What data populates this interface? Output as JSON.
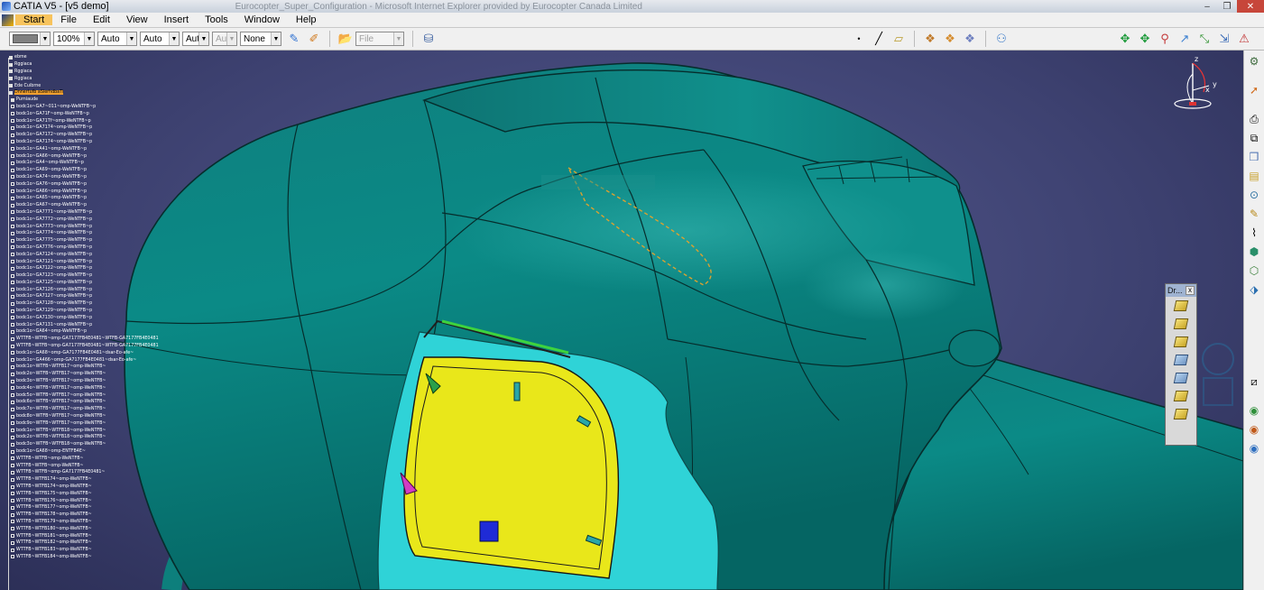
{
  "window": {
    "title": "CATIA V5 - [v5 demo]",
    "blurred_caption": "Eurocopter_Super_Configuration - Microsoft Internet Explorer provided by Eurocopter Canada Limited",
    "minimize_glyph": "–",
    "restore_glyph": "❐",
    "close_glyph": "✕"
  },
  "menu": {
    "items": [
      "Start",
      "File",
      "Edit",
      "View",
      "Insert",
      "Tools",
      "Window",
      "Help"
    ]
  },
  "toolbar": {
    "zoom_value": "100%",
    "line_type_value": "Auto",
    "line_thickness_value": "Auto",
    "layer_value": "Aut",
    "linetype_disabled_value": "Aut",
    "rendering_value": "None",
    "file_combo_value": "File"
  },
  "tree": {
    "selected_index": 5,
    "items": [
      "ebme",
      "Rggiaca",
      "Rggiaca",
      "Rggiaca",
      "Ede Cuibrne",
      "Dnnertufb aSlerhdbaTi",
      "Purniaude",
      "bodc1o~GA7~011~omp-WeNTFB~p",
      "bodc1o~GA71F~omp-WeNTFB~p",
      "bodc1o~GA71Tf~omp-WeNTFB~p",
      "bodc1o~GA7174~omp-WeNTFB~p",
      "bodc1o~GA7172~omp-WeNTFB~p",
      "bodc1o~GA7174~omp-WeNTFB~p",
      "bodc1o~GA41~omp-WeNTFB~p",
      "bodc1o~GA66~omp-WeNTFB~p",
      "bodc1o~GA4~omp-WeNTFB~p",
      "bodc1o~GA69~omp-WeNTFB~p",
      "bodc1o~GA74~omp-WeNTFB~p",
      "bodc1o~GA76~omp-WeNTFB~p",
      "bodc1o~GA66~omp-WeNTFB~p",
      "bodc1o~GA65~omp-WeNTFB~p",
      "bodc1o~GA67~omp-WeNTFB~p",
      "bodc1o~GA7771~omp-WeNTFB~p",
      "bodc1o~GA7772~omp-WeNTFB~p",
      "bodc1o~GA7773~omp-WeNTFB~p",
      "bodc1o~GA7774~omp-WeNTFB~p",
      "bodc1o~GA7775~omp-WeNTFB~p",
      "bodc1o~GA7776~omp-WeNTFB~p",
      "bodc1o~GA7124~omp-WeNTFB~p",
      "bodc1o~GA7121~omp-WeNTFB~p",
      "bodc1o~GA7122~omp-WeNTFB~p",
      "bodc1o~GA7123~omp-WeNTFB~p",
      "bodc1o~GA7125~omp-WeNTFB~p",
      "bodc1o~GA7126~omp-WeNTFB~p",
      "bodc1o~GA7127~omp-WeNTFB~p",
      "bodc1o~GA7128~omp-WeNTFB~p",
      "bodc1o~GA7129~omp-WeNTFB~p",
      "bodc1o~GA7130~omp-WeNTFB~p",
      "bodc1o~GA7131~omp-WeNTFB~p",
      "bodc1o~GA64~omp-WeNTFB~p",
      "WTTFB~WTFB~omp-GA7177FB4E0481~WTFB-GA7177FB4E0481",
      "WTTFB~WTFB~omp-GA7177FB4E0481~WTFB-GA7177FB4E0481",
      "bodc1o~GA68~omp-GA7177FB4E0481~dsar-Eo-afe~",
      "bodc1o~GA466~omp-GA7177FB4E0481~dsar-Eo-afe~",
      "bodc1o~WTFB~WTFB17~omp-WeNTFB~",
      "bodc2o~WTFB~WTFB17~omp-WeNTFB~",
      "bodc3o~WTFB~WTFB17~omp-WeNTFB~",
      "bodc4o~WTFB~WTFB17~omp-WeNTFB~",
      "bodc5o~WTFB~WTFB17~omp-WeNTFB~",
      "bodc6o~WTFB~WTFB17~omp-WeNTFB~",
      "bodc7o~WTFB~WTFB17~omp-WeNTFB~",
      "bodc8o~WTFB~WTFB17~omp-WeNTFB~",
      "bodc9o~WTFB~WTFB17~omp-WeNTFB~",
      "bodc1o~WTFB~WTFB18~omp-WeNTFB~",
      "bodc2o~WTFB~WTFB18~omp-WeNTFB~",
      "bodc3o~WTFB~WTFB18~omp-WeNTFB~",
      "bodc1o~GA68~omp-ENTFB4E~",
      "WTTFB~WTFB~omp-WeNTFB~",
      "WTTFB~WTFB~omp-WeNTFB~",
      "WTTFB~WTFB~omp-GA7177FB4E0481~",
      "WTTFB~WTFB174~omp-WeNTFB~",
      "WTTFB~WTFB174~omp-WeNTFB~",
      "WTTFB~WTFB175~omp-WeNTFB~",
      "WTTFB~WTFB176~omp-WeNTFB~",
      "WTTFB~WTFB177~omp-WeNTFB~",
      "WTTFB~WTFB178~omp-WeNTFB~",
      "WTTFB~WTFB179~omp-WeNTFB~",
      "WTTFB~WTFB180~omp-WeNTFB~",
      "WTTFB~WTFB181~omp-WeNTFB~",
      "WTTFB~WTFB182~omp-WeNTFB~",
      "WTTFB~WTFB183~omp-WeNTFB~",
      "WTTFB~WTFB184~omp-WeNTFB~"
    ]
  },
  "compass": {
    "x": "x",
    "y": "y",
    "z": "z"
  },
  "drafting_panel": {
    "title": "Dr...",
    "close_glyph": "x"
  },
  "colors": {
    "viewport_bg": "#3f4370",
    "hull": "#0e8582",
    "window_fill": "#e8e614",
    "frame": "#2fd0d4",
    "selection_highlight": "#f0a030"
  }
}
